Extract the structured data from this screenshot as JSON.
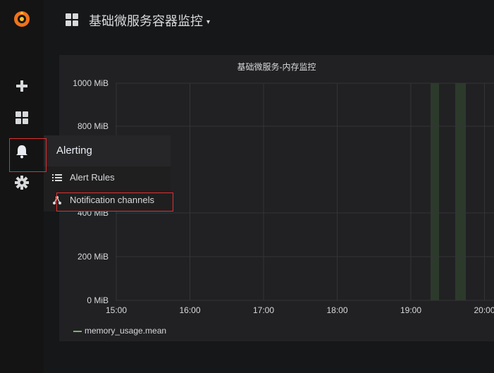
{
  "dashboard": {
    "title": "基础微服务容器监控",
    "caret": "▾"
  },
  "sidebar": {
    "items": [
      {
        "icon": "grafana-logo-icon"
      },
      {
        "icon": "plus-icon"
      },
      {
        "icon": "dashboards-grid-icon"
      },
      {
        "icon": "bell-icon",
        "active": true
      },
      {
        "icon": "gear-icon"
      }
    ]
  },
  "alerting_menu": {
    "title": "Alerting",
    "items": [
      {
        "label": "Alert Rules",
        "icon": "list-icon"
      },
      {
        "label": "Notification channels",
        "icon": "share-nodes-icon"
      }
    ]
  },
  "panel": {
    "title": "基础微服务-内存监控",
    "legend": "memory_usage.mean",
    "legend_color": "#7eb26d"
  },
  "chart_data": {
    "type": "line",
    "title": "基础微服务-内存监控",
    "xlabel": "",
    "ylabel": "",
    "yticks": [
      "0 MiB",
      "200 MiB",
      "400 MiB",
      "800 MiB",
      "1000 MiB"
    ],
    "xticks": [
      "15:00",
      "16:00",
      "17:00",
      "18:00",
      "19:00",
      "20:00"
    ],
    "ylim": [
      0,
      1000
    ],
    "series": [
      {
        "name": "memory_usage.mean",
        "values": []
      }
    ],
    "grid": true,
    "legend": "bottom-left"
  },
  "colors": {
    "highlight": "#e02f2f",
    "accent": "#eb7b18"
  }
}
